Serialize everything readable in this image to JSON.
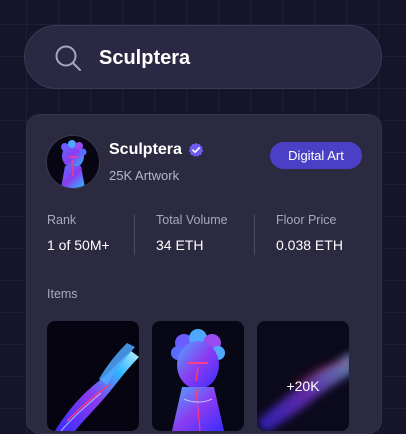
{
  "search": {
    "value": "Sculptera",
    "icon": "search-icon"
  },
  "collection": {
    "name": "Sculptera",
    "verified": true,
    "artwork_count": "25K Artwork",
    "category": "Digital Art",
    "accent_color": "#4b3fc6",
    "verified_color": "#6f5cf0"
  },
  "stats": [
    {
      "label": "Rank",
      "value": "1 of 50M+"
    },
    {
      "label": "Total Volume",
      "value": "34 ETH"
    },
    {
      "label": "Floor Price",
      "value": "0.038 ETH"
    }
  ],
  "items": {
    "label": "Items",
    "more_count": "+20K"
  }
}
